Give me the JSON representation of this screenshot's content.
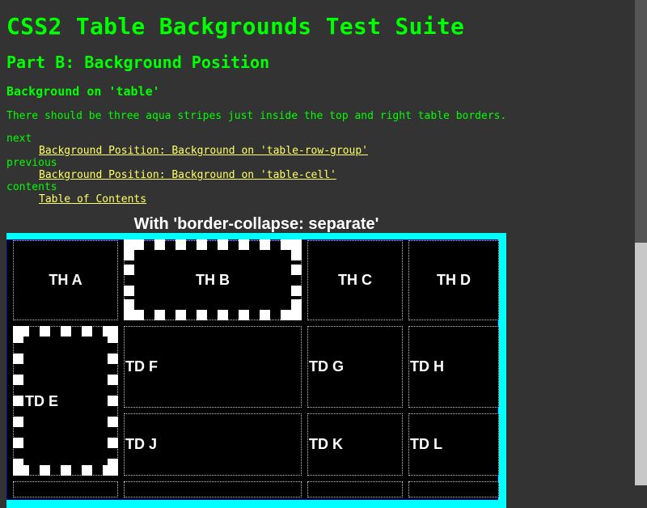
{
  "headings": {
    "main": "CSS2 Table Backgrounds Test Suite",
    "part": "Part B: Background Position",
    "section": "Background on 'table'"
  },
  "description": "There should be three aqua stripes just inside the top and right table borders.",
  "nav": {
    "next_term": "next",
    "next_link": "Background Position: Background on 'table-row-group'",
    "previous_term": "previous",
    "previous_link": "Background Position: Background on 'table-cell'",
    "contents_term": "contents",
    "contents_link": "Table of Contents"
  },
  "table": {
    "caption": "With 'border-collapse: separate'",
    "headers": [
      "TH A",
      "TH B",
      "TH C",
      "TH D"
    ],
    "cells": [
      "TD E",
      "TD F",
      "TD G",
      "TD H",
      "TD J",
      "TD K",
      "TD L"
    ]
  },
  "colors": {
    "background": "#333333",
    "text": "#00ff00",
    "link": "#ffff66",
    "stripe": "#00ffff",
    "cell_background": "#000000"
  }
}
